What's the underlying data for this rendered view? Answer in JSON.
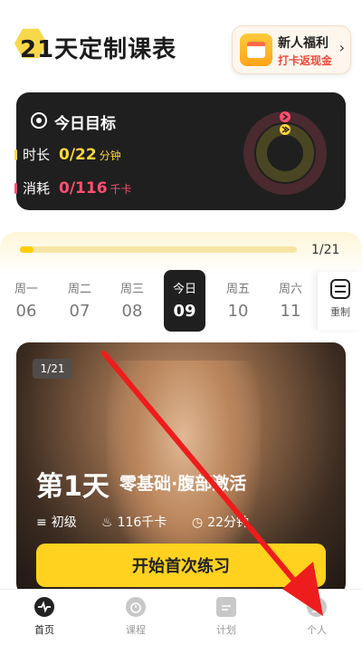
{
  "header": {
    "title": "21天定制课表"
  },
  "promo": {
    "title": "新人福利",
    "subtitle": "打卡返现金",
    "arrow": "›"
  },
  "goal": {
    "title": "今日目标",
    "time_label": "时长",
    "time_value": "0/22",
    "time_unit": "分钟",
    "cal_label": "消耗",
    "cal_value": "0/116",
    "cal_unit": "千卡",
    "colors": {
      "time": "#ffd83a",
      "cal": "#ff4f72"
    },
    "time_progress": 0,
    "cal_progress": 0
  },
  "progress": {
    "text": "1/21",
    "fraction": 0.0476
  },
  "week": {
    "days": [
      {
        "name": "周一",
        "num": "06"
      },
      {
        "name": "周二",
        "num": "07"
      },
      {
        "name": "周三",
        "num": "08"
      },
      {
        "name": "今日",
        "num": "09"
      },
      {
        "name": "周五",
        "num": "10"
      },
      {
        "name": "周六",
        "num": "11"
      }
    ],
    "reset_label": "重制"
  },
  "course": {
    "badge": "1/21",
    "day_title": "第1天",
    "name": "零基础·腹部激活",
    "level": "初级",
    "calories": "116千卡",
    "duration": "22分钟",
    "start_label": "开始首次练习"
  },
  "tabs": [
    {
      "label": "首页",
      "icon": "pulse-icon"
    },
    {
      "label": "课程",
      "icon": "stopwatch-icon"
    },
    {
      "label": "计划",
      "icon": "calendar-icon"
    },
    {
      "label": "个人",
      "icon": "person-icon"
    }
  ]
}
